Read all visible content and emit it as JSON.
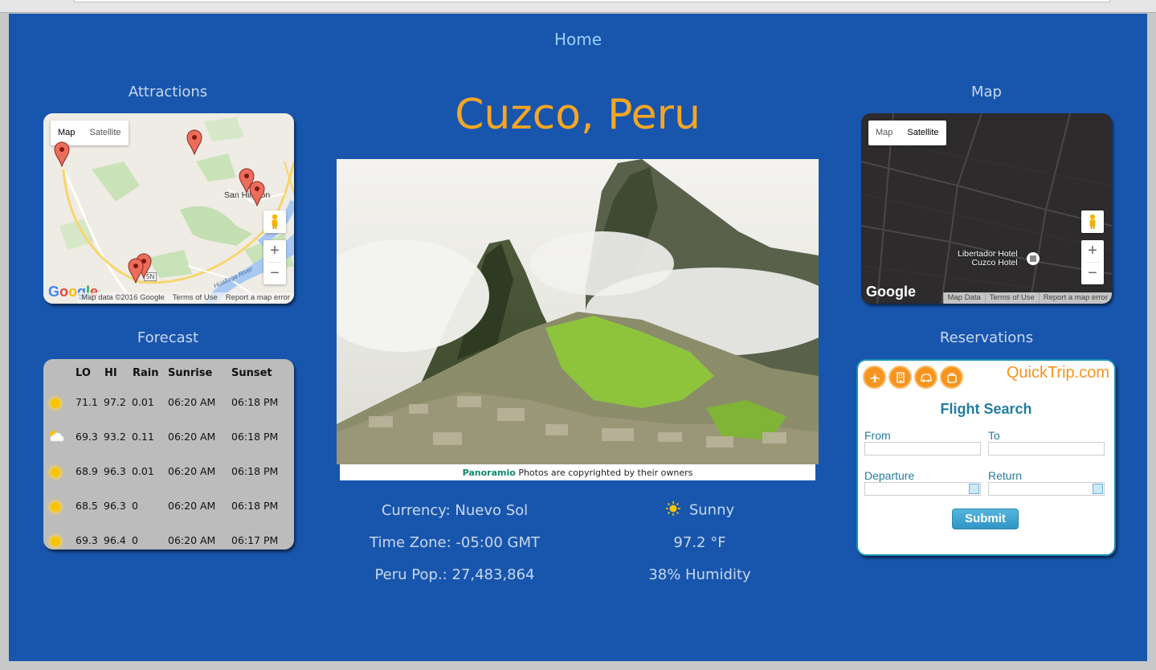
{
  "nav": {
    "home_label": "Home"
  },
  "page": {
    "title": "Cuzco, Peru"
  },
  "attractions": {
    "title": "Attractions",
    "map_type": {
      "map_label": "Map",
      "satellite_label": "Satellite",
      "selected": "Map"
    },
    "place_label": "San Hilarion",
    "road_label": "5N",
    "river_label": "Huallaga River",
    "attribution": {
      "data": "Map data ©2016 Google",
      "terms": "Terms of Use",
      "report": "Report a map error"
    }
  },
  "map": {
    "title": "Map",
    "map_type": {
      "map_label": "Map",
      "satellite_label": "Satellite",
      "selected": "Satellite"
    },
    "hotel_label_line1": "Libertador Hotel",
    "hotel_label_line2": "Cuzco Hotel",
    "attribution": {
      "data": "Map Data",
      "terms": "Terms of Use",
      "report": "Report a map error"
    }
  },
  "forecast": {
    "title": "Forecast",
    "columns": [
      "LO",
      "HI",
      "Rain",
      "Sunrise",
      "Sunset"
    ],
    "rows": [
      {
        "icon": "sun-icon",
        "lo": "71.1",
        "hi": "97.2",
        "rain": "0.01",
        "sunrise": "06:20 AM",
        "sunset": "06:18 PM"
      },
      {
        "icon": "partly-cloudy-icon",
        "lo": "69.3",
        "hi": "93.2",
        "rain": "0.11",
        "sunrise": "06:20 AM",
        "sunset": "06:18 PM"
      },
      {
        "icon": "sun-icon",
        "lo": "68.9",
        "hi": "96.3",
        "rain": "0.01",
        "sunrise": "06:20 AM",
        "sunset": "06:18 PM"
      },
      {
        "icon": "sun-icon",
        "lo": "68.5",
        "hi": "96.3",
        "rain": "0",
        "sunrise": "06:20 AM",
        "sunset": "06:18 PM"
      },
      {
        "icon": "sun-icon",
        "lo": "69.3",
        "hi": "96.4",
        "rain": "0",
        "sunrise": "06:20 AM",
        "sunset": "06:17 PM"
      }
    ]
  },
  "photo": {
    "credit_brand": "Panoramio",
    "credit_text": "Photos are copyrighted by their owners"
  },
  "info": {
    "currency": "Currency: Nuevo Sol",
    "timezone": "Time Zone: -05:00 GMT",
    "population": "Peru Pop.: 27,483,864",
    "weather": "Sunny",
    "temperature": "97.2 °F",
    "humidity": "38% Humidity"
  },
  "reservations": {
    "title": "Reservations",
    "logo": "QuickTrip.com",
    "heading": "Flight Search",
    "from_label": "From",
    "to_label": "To",
    "departure_label": "Departure",
    "return_label": "Return",
    "submit_label": "Submit",
    "icons": [
      "plane-icon",
      "hotel-icon",
      "car-icon",
      "luggage-icon"
    ]
  },
  "colors": {
    "page_bg": "#1856ae",
    "title": "#f5a623",
    "section_text": "#c9d8ec",
    "home_link": "#9ccfff",
    "quicktrip_orange": "#f7941d",
    "quicktrip_blue": "#237ca0"
  }
}
